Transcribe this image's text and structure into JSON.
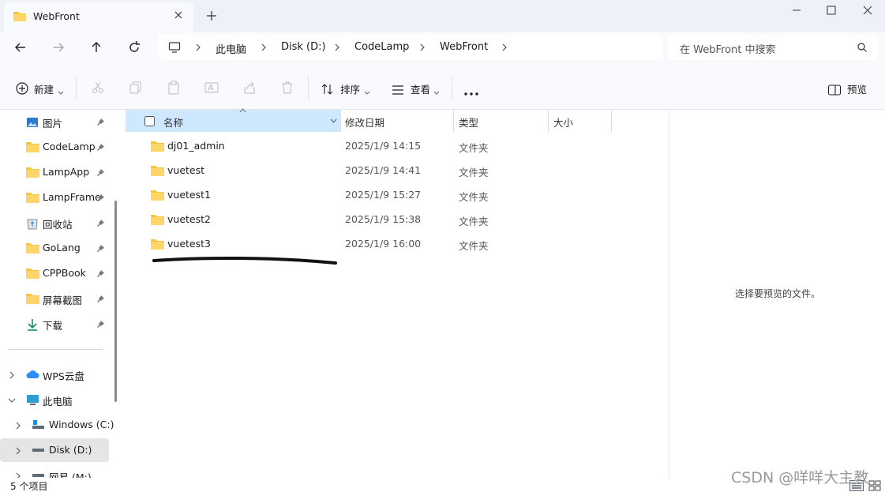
{
  "window": {
    "tab_title": "WebFront",
    "minimize_label": "minimize",
    "maximize_label": "maximize",
    "close_label": "close"
  },
  "address": {
    "crumbs": [
      "此电脑",
      "Disk (D:)",
      "CodeLamp",
      "WebFront"
    ]
  },
  "search": {
    "placeholder": "在 WebFront 中搜索"
  },
  "toolbar": {
    "new_label": "新建",
    "sort_label": "排序",
    "view_label": "查看",
    "preview_label": "预览"
  },
  "sidebar": {
    "quick": [
      {
        "label": "图片",
        "icon": "pictures-icon"
      },
      {
        "label": "CodeLamp",
        "icon": "folder-icon"
      },
      {
        "label": "LampApp",
        "icon": "folder-icon"
      },
      {
        "label": "LampFrame",
        "icon": "folder-icon"
      },
      {
        "label": "回收站",
        "icon": "recycle-bin-icon"
      },
      {
        "label": "GoLang",
        "icon": "folder-icon"
      },
      {
        "label": "CPPBook",
        "icon": "folder-icon"
      },
      {
        "label": "屏幕截图",
        "icon": "folder-icon"
      },
      {
        "label": "下载",
        "icon": "download-icon"
      }
    ],
    "tree": [
      {
        "label": "WPS云盘",
        "icon": "cloud-icon"
      },
      {
        "label": "此电脑",
        "icon": "computer-icon"
      },
      {
        "label": "Windows (C:)",
        "icon": "drive-icon"
      },
      {
        "label": "Disk (D:)",
        "icon": "drive-icon"
      },
      {
        "label": "网易 (M:)",
        "icon": "drive-icon"
      }
    ]
  },
  "columns": {
    "name": "名称",
    "date": "修改日期",
    "type": "类型",
    "size": "大小"
  },
  "files": [
    {
      "name": "dj01_admin",
      "date": "2025/1/9 14:15",
      "type": "文件夹"
    },
    {
      "name": "vuetest",
      "date": "2025/1/9 14:41",
      "type": "文件夹"
    },
    {
      "name": "vuetest1",
      "date": "2025/1/9 15:27",
      "type": "文件夹"
    },
    {
      "name": "vuetest2",
      "date": "2025/1/9 15:38",
      "type": "文件夹"
    },
    {
      "name": "vuetest3",
      "date": "2025/1/9 16:00",
      "type": "文件夹"
    }
  ],
  "preview": {
    "message": "选择要预览的文件。"
  },
  "status": {
    "count": "5 个项目"
  },
  "watermark": "CSDN @咩咩大主教",
  "colors": {
    "folder": "#f8c43a",
    "selected_header": "#cde8ff",
    "title_bg": "#eef2f8"
  }
}
